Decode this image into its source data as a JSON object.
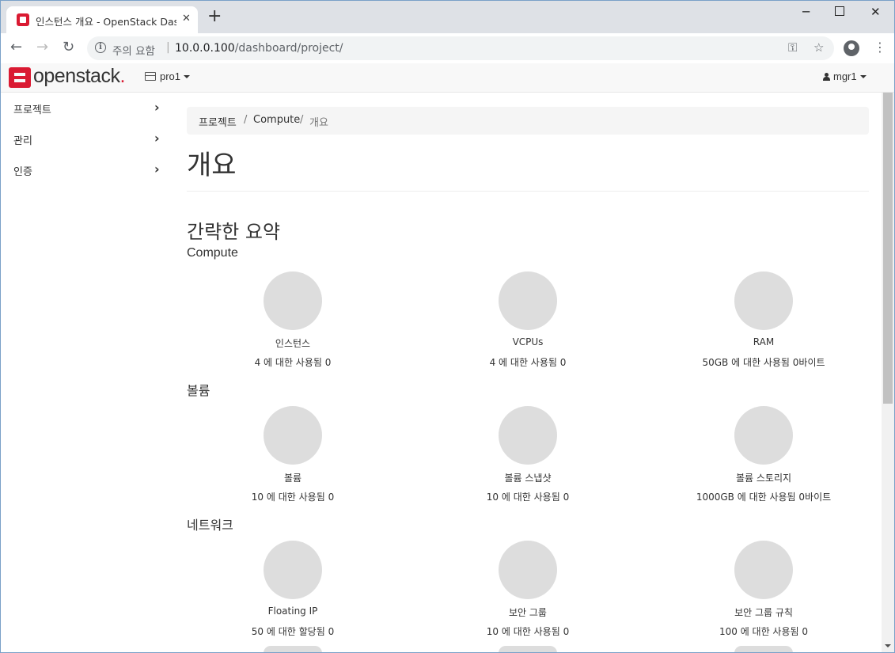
{
  "browser": {
    "tab_title": "인스턴스 개요 - OpenStack Dashboard",
    "security_label": "주의 요함",
    "url_host": "10.0.0.100",
    "url_path": "/dashboard/project/"
  },
  "navbar": {
    "logo_text": "openstack",
    "logo_dot": ".",
    "project": "pro1",
    "user": "mgr1"
  },
  "sidebar": {
    "items": [
      {
        "label": "프로젝트"
      },
      {
        "label": "관리"
      },
      {
        "label": "인증"
      }
    ]
  },
  "breadcrumb": [
    "프로젝트",
    "Compute",
    "개요"
  ],
  "page_title": "개요",
  "summary_title": "간략한 요약",
  "sections": [
    {
      "title": "Compute",
      "charts": [
        {
          "label": "인스턴스",
          "usage": "4 에 대한 사용됨 0"
        },
        {
          "label": "VCPUs",
          "usage": "4 에 대한 사용됨 0"
        },
        {
          "label": "RAM",
          "usage": "50GB 에 대한 사용됨 0바이트"
        }
      ]
    },
    {
      "title": "볼륨",
      "charts": [
        {
          "label": "볼륨",
          "usage": "10 에 대한 사용됨 0"
        },
        {
          "label": "볼륨 스냅샷",
          "usage": "10 에 대한 사용됨 0"
        },
        {
          "label": "볼륨 스토리지",
          "usage": "1000GB 에 대한 사용됨 0바이트"
        }
      ]
    },
    {
      "title": "네트워크",
      "charts": [
        {
          "label": "Floating IP",
          "usage": "50 에 대한 할당됨 0"
        },
        {
          "label": "보안 그룹",
          "usage": "10 에 대한 사용됨 0"
        },
        {
          "label": "보안 그룹 규칙",
          "usage": "100 에 대한 사용됨 0"
        }
      ]
    }
  ],
  "colors": {
    "brand": "#da1a32",
    "pie_empty": "#dddddd"
  }
}
